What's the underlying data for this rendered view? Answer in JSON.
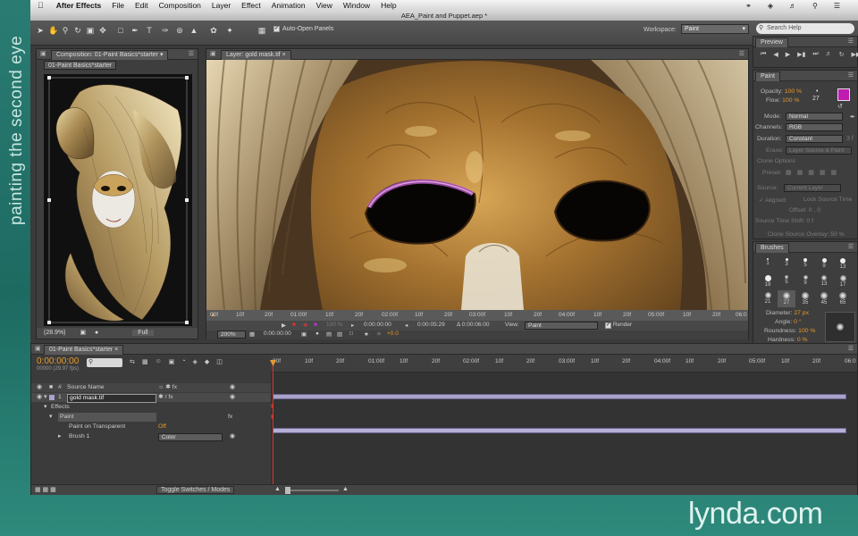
{
  "overlay": {
    "side_text": "painting the second eye",
    "watermark": "lynda.com"
  },
  "menubar": {
    "apple": "",
    "app_name": "After Effects",
    "items": [
      "File",
      "Edit",
      "Composition",
      "Layer",
      "Effect",
      "Animation",
      "View",
      "Window",
      "Help"
    ]
  },
  "window": {
    "title": "AEA_Paint and Puppet.aep *"
  },
  "toolbar": {
    "auto_open_label": "Auto-Open Panels",
    "workspace_label": "Workspace:",
    "workspace_value": "Paint",
    "search_placeholder": "Search Help"
  },
  "comp_panel": {
    "tab": "Composition: 01-Paint Basics*starter",
    "subtab": "01-Paint Basics*starter",
    "zoom": "(28.9%)",
    "resolution": "Full"
  },
  "layer_panel": {
    "tab": "Layer: gold mask.tif",
    "ruler_labels": [
      "00f",
      "10f",
      "20f",
      "01:00f",
      "10f",
      "20f",
      "02:00f",
      "10f",
      "20f",
      "03:00f",
      "10f",
      "20f",
      "04:00f",
      "10f",
      "20f",
      "05:00f",
      "10f",
      "20f",
      "06:0"
    ],
    "percent": "100 %",
    "time_in": "0:00:00:00",
    "time_out": "0:00:05:29",
    "duration": "Δ 0:00:06:00",
    "view_label": "View:",
    "view_value": "Paint",
    "render_label": "Render",
    "zoom": "200%",
    "timecode": "0:00:00:00",
    "exposure": "+0.0"
  },
  "preview_panel": {
    "tab": "Preview"
  },
  "paint_panel": {
    "tab": "Paint",
    "opacity_label": "Opacity:",
    "opacity_value": "100 %",
    "flow_label": "Flow:",
    "flow_value": "100 %",
    "brush_size": "27",
    "mode_label": "Mode:",
    "mode_value": "Normal",
    "channels_label": "Channels:",
    "channels_value": "RGB",
    "duration_label": "Duration:",
    "duration_value": "Constant",
    "duration_frames": "3 f",
    "erase_label": "Erase:",
    "erase_value": "Layer Source & Paint",
    "clone_options": "Clone Options",
    "preset_label": "Preset:",
    "source_label": "Source:",
    "source_value": "Current Layer",
    "aligned_label": "Aligned",
    "lock_source_time": "Lock Source Time",
    "offset_label": "Offset:",
    "offset_value": "0 , 0",
    "source_time_shift": "Source Time Shift:",
    "source_time_shift_value": "0 f",
    "clone_overlay": "Clone Source Overlay:",
    "clone_overlay_value": "50 %",
    "foreground_color": "#c01bb0",
    "background_color": "#1a1a1a"
  },
  "brushes_panel": {
    "tab": "Brushes",
    "sizes": [
      "1",
      "3",
      "5",
      "9",
      "13",
      "19",
      "5",
      "9",
      "13",
      "17",
      "21",
      "27",
      "35",
      "45",
      "65"
    ],
    "diameter_label": "Diameter:",
    "diameter_value": "27 px",
    "angle_label": "Angle:",
    "angle_value": "0 °",
    "roundness_label": "Roundness:",
    "roundness_value": "100 %",
    "hardness_label": "Hardness:",
    "hardness_value": "0 %"
  },
  "timeline": {
    "tab": "01-Paint Basics*starter",
    "timecode": "0:00:00:00",
    "fps": "00000 (29.97 fps)",
    "col_num": "#",
    "col_source": "Source Name",
    "layer_num": "1",
    "layer_name": "gold mask.tif",
    "effects_label": "Effects",
    "paint_label": "Paint",
    "fx_label": "fx",
    "paint_on_transparent_label": "Paint on Transparent",
    "paint_on_transparent_value": "Off",
    "brush_label": "Brush 1",
    "blend_value": "Color",
    "ruler_labels": [
      "00f",
      "10f",
      "20f",
      "01:00f",
      "10f",
      "20f",
      "02:00f",
      "10f",
      "20f",
      "03:00f",
      "10f",
      "20f",
      "04:00f",
      "10f",
      "20f",
      "05:00f",
      "10f",
      "20f",
      "06:0"
    ],
    "toggle_label": "Toggle Switches / Modes"
  }
}
